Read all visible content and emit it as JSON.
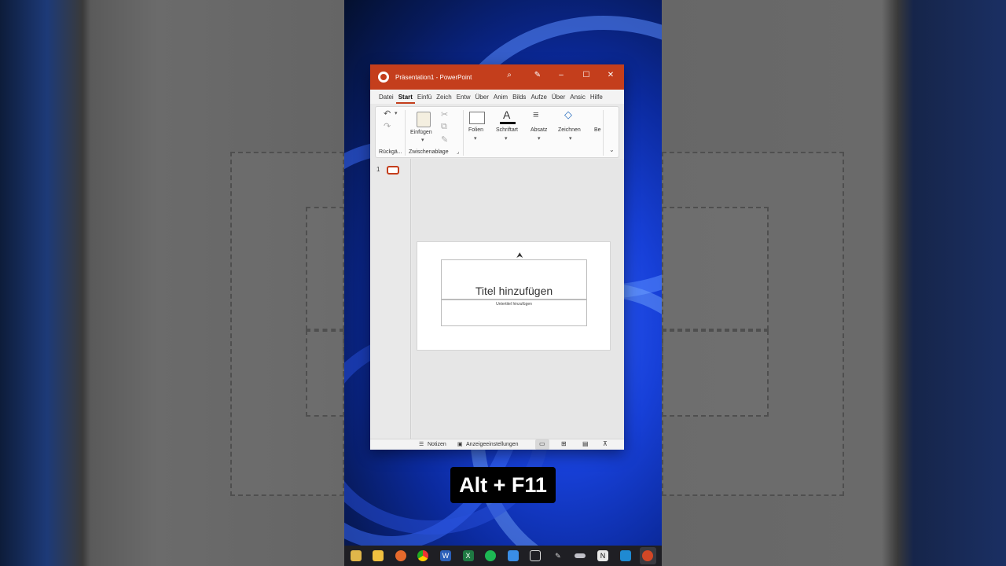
{
  "window": {
    "title": "Präsentation1 - PowerPoint",
    "accent": "#c43e1c",
    "search_icon": "search-icon",
    "pen_icon": "pen-icon",
    "min_glyph": "–",
    "max_glyph": "☐",
    "close_glyph": "✕"
  },
  "tabs": [
    "Datei",
    "Start",
    "Einfü",
    "Zeich",
    "Entw",
    "Über",
    "Anim",
    "Bilds",
    "Aufze",
    "Über",
    "Ansic",
    "Hilfe"
  ],
  "ribbon": {
    "groups": {
      "undo_label": "Rückgä...",
      "clipboard_label": "Zwischenablage",
      "paste_label": "Einfügen",
      "slides_label": "Folien",
      "font_label": "Schriftart",
      "paragraph_label": "Absatz",
      "drawing_label": "Zeichnen",
      "more_label": "Be"
    }
  },
  "thumbnails": {
    "slide_number": "1"
  },
  "slide": {
    "title_placeholder": "Titel hinzufügen",
    "subtitle_placeholder": "Untertitel hinzufügen"
  },
  "statusbar": {
    "notes_label": "Notizen",
    "display_settings_label": "Anzeigeeinstellungen"
  },
  "caption": "Alt + F11",
  "taskbar": {
    "apps": [
      {
        "name": "file-explorer-icon",
        "color": "#e0b64a",
        "glyph": ""
      },
      {
        "name": "folder-icon",
        "color": "#f0c040",
        "glyph": ""
      },
      {
        "name": "firefox-icon",
        "color": "#e66a2c",
        "glyph": ""
      },
      {
        "name": "chrome-icon",
        "color": "#3a8ee6",
        "glyph": ""
      },
      {
        "name": "word-icon",
        "color": "#2b5fb8",
        "glyph": "W"
      },
      {
        "name": "excel-icon",
        "color": "#1f7a43",
        "glyph": "X"
      },
      {
        "name": "spotify-icon",
        "color": "#1db954",
        "glyph": ""
      },
      {
        "name": "mail-icon",
        "color": "#3a8ee6",
        "glyph": ""
      },
      {
        "name": "remote-desktop-icon",
        "color": "#555a66",
        "glyph": ""
      },
      {
        "name": "pen-app-icon",
        "color": "#555a66",
        "glyph": ""
      },
      {
        "name": "tool-icon",
        "color": "#c0c0c8",
        "glyph": ""
      },
      {
        "name": "notion-icon",
        "color": "#e8e8e8",
        "glyph": "N"
      },
      {
        "name": "vscode-icon",
        "color": "#1f8ad2",
        "glyph": ""
      },
      {
        "name": "powerpoint-icon",
        "color": "#d24726",
        "glyph": ""
      }
    ]
  }
}
